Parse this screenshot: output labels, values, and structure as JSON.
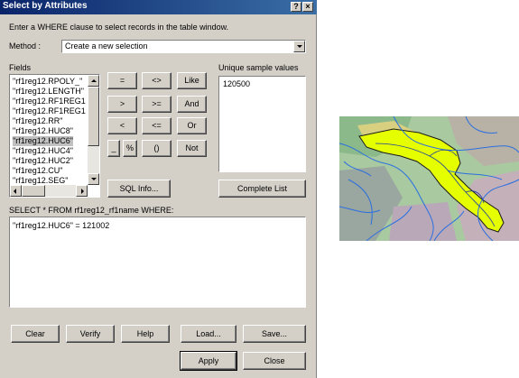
{
  "window": {
    "title": "Select by Attributes",
    "help_glyph": "?",
    "close_glyph": "×"
  },
  "instruction": "Enter a WHERE clause to select records in the table window.",
  "method": {
    "label": "Method :",
    "value": "Create a new selection"
  },
  "fields": {
    "label": "Fields",
    "items": [
      "\"rf1reg12.RPOLY_\"",
      "\"rf1reg12.LENGTH\"",
      "\"rf1reg12.RF1REG1",
      "\"rf1reg12.RF1REG1",
      "\"rf1reg12.RR\"",
      "\"rf1reg12.HUC8\"",
      "\"rf1reg12.HUC6\"",
      "\"rf1reg12.HUC4\"",
      "\"rf1reg12.HUC2\"",
      "\"rf1reg12.CU\"",
      "\"rf1reg12.SEG\""
    ],
    "selected_index": 6
  },
  "operators": {
    "eq": "=",
    "ne": "<>",
    "like": "Like",
    "gt": ">",
    "ge": ">=",
    "and": "And",
    "lt": "<",
    "le": "<=",
    "or": "Or",
    "underscore": "_",
    "percent": "%",
    "parens": "()",
    "not": "Not"
  },
  "sql_info_button": "SQL Info...",
  "unique_values": {
    "label": "Unique sample values",
    "items": [
      "120500"
    ]
  },
  "complete_list_button": "Complete List",
  "select_statement": "SELECT * FROM rf1reg12_rf1name WHERE:",
  "where_clause": "\"rf1reg12.HUC6\" = 121002",
  "buttons": {
    "clear": "Clear",
    "verify": "Verify",
    "help": "Help",
    "load": "Load...",
    "save": "Save...",
    "apply": "Apply",
    "close": "Close"
  },
  "colors": {
    "title_start": "#0a246a",
    "title_end": "#3a6ea5",
    "dialog_bg": "#d4d0c8",
    "highlight": "#e6ff00",
    "river": "#2a6fe0"
  }
}
